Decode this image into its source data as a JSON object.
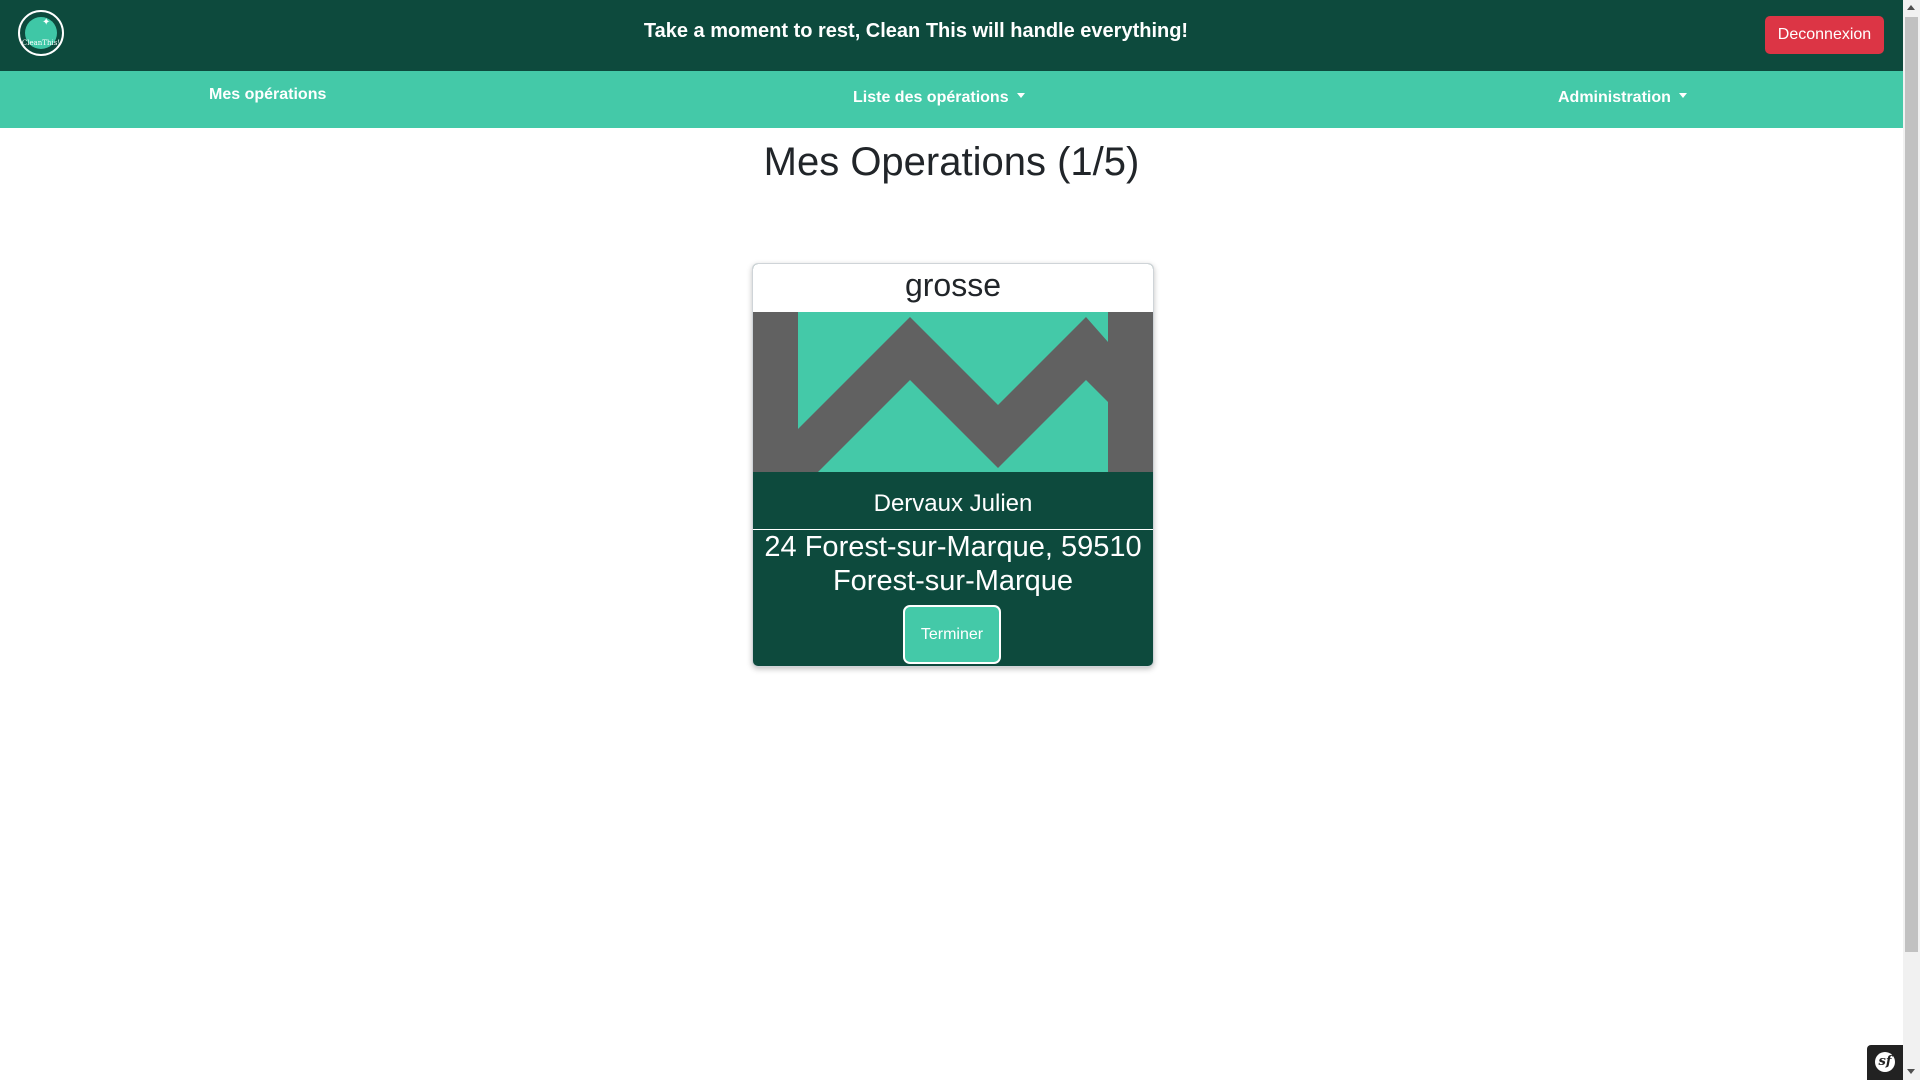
{
  "header": {
    "logo_text": "CleanThis!",
    "tagline": "Take a moment to rest, Clean This will handle everything!",
    "logout_label": "Deconnexion"
  },
  "nav": {
    "mine": "Mes opérations",
    "list": "Liste des opérations",
    "admin": "Administration"
  },
  "main": {
    "title": "Mes Operations (1/5)"
  },
  "card": {
    "type": "grosse",
    "client_name": "Dervaux Julien",
    "address": "24 Forest-sur-Marque, 59510 Forest-sur-Marque",
    "finish_label": "Terminer"
  },
  "colors": {
    "header_bg": "#0d4a3d",
    "nav_bg": "#44c9a8",
    "danger": "#dc3545",
    "image_gray": "#616161",
    "image_green": "#44c9a8"
  },
  "icons": {
    "logo": "cleanthis-logo-icon",
    "symfony": "symfony-icon"
  }
}
